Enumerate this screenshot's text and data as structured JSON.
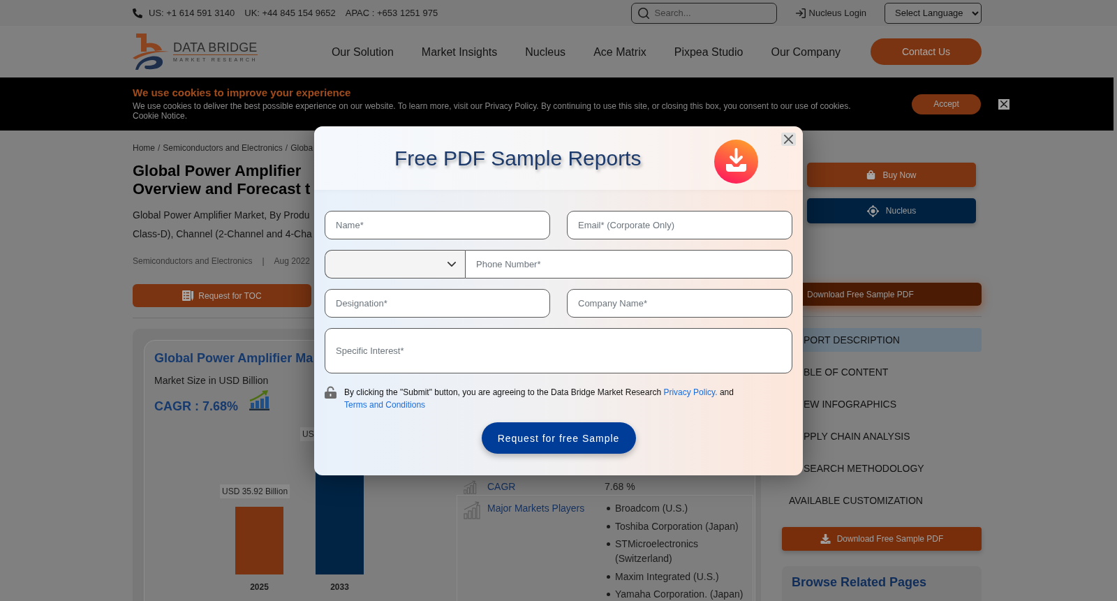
{
  "top_bar": {
    "phones": [
      "US: +1 614 591 3140",
      "UK: +44 845 154 9652",
      "APAC : +653 1251 975"
    ],
    "search": {
      "placeholder": "Search..."
    },
    "login": "Nucleus Login",
    "language": "Select Language"
  },
  "header": {
    "logo": {
      "name": "DATA BRIDGE",
      "tagline": "MARKET RESEARCH"
    },
    "nav": [
      "Our Solution",
      "Market Insights",
      "Nucleus",
      "Ace Matrix",
      "Pixpea Studio",
      "Our Company"
    ],
    "contact_button": "Contact Us"
  },
  "cookie_banner": {
    "title": "We use cookies to improve your experience",
    "text": "We use cookies to deliver the best possible experience on our website. To learn more, visit our Privacy Policy. By continuing to use this site, or closing this box, you consent to our use of cookies. Cookie Notice.",
    "accept_button": "Accept"
  },
  "breadcrumb": {
    "separator": "/",
    "items": [
      "Home",
      "Semiconductors and Electronics",
      "Globa"
    ]
  },
  "report": {
    "title_lines": [
      "Global Power Amplifier",
      "Overview and Forecast t"
    ],
    "description_lines": [
      "Global Power Amplifier Market, By Produ",
      "Class-D), Channel (2-Channel and 4-Cha"
    ],
    "meta": {
      "category": "Semiconductors and Electronics",
      "separator": "|",
      "date": "Aug 2022"
    },
    "toc_button": "Request for TOC"
  },
  "market_card": {
    "title": "Global Power Amplifier Ma",
    "subtitle": "Market Size in USD Billion",
    "cagr": "CAGR : 7.68%",
    "bars": [
      {
        "category": "2025",
        "value_label": "USD 35.92 Billion",
        "color": "#7a3311"
      },
      {
        "category": "2033",
        "value_label": "US",
        "color": "#012445"
      }
    ]
  },
  "market_table": {
    "rows": [
      {
        "kind": "value",
        "label": "CAGR",
        "value": "7.68 %"
      },
      {
        "kind": "list",
        "label": "Major Markets Players",
        "items": [
          "Broadcom (U.S.)",
          "Toshiba Corporation (Japan)",
          "STMicroelectronics (Switzerland)",
          "Maxim Integrated (U.S.)",
          "Yamaha Corporation. (Japan)"
        ]
      }
    ]
  },
  "sidebar": {
    "buy_button": "Buy Now",
    "nucleus_button": "Nucleus",
    "sample_button": "Download Free Sample PDF",
    "sections": [
      {
        "label": "PORT DESCRIPTION",
        "selected": true
      },
      {
        "label": "BLE OF CONTENT",
        "selected": false
      },
      {
        "label": "EW INFOGRAPHICS",
        "selected": false
      },
      {
        "label": "PPLY CHAIN ANALYSIS",
        "selected": false
      },
      {
        "label": "SEARCH METHODOLOGY",
        "selected": false
      },
      {
        "label": "AVAILABLE CUSTOMIZATION",
        "selected": false
      }
    ],
    "download_button": "Download Free Sample PDF",
    "related_title": "Browse Related Pages"
  },
  "modal": {
    "title": "Free PDF Sample Reports",
    "fields": [
      {
        "kind": "text",
        "placeholder": "Name*"
      },
      {
        "kind": "text",
        "placeholder": "Email* (Corporate Only)"
      },
      {
        "kind": "phone",
        "placeholder": "Phone Number*"
      },
      {
        "kind": "text",
        "placeholder": "Designation*"
      },
      {
        "kind": "text",
        "placeholder": "Company Name*"
      },
      {
        "kind": "textarea",
        "placeholder": "Specific Interest*"
      }
    ],
    "consent": {
      "text": "By clicking the \"Submit\" button, you are agreeing to the Data Bridge Market Research",
      "privacy_link": "Privacy Policy.",
      "joiner": "and",
      "terms_link": "Terms and Conditions"
    },
    "submit_button": "Request for free Sample"
  }
}
